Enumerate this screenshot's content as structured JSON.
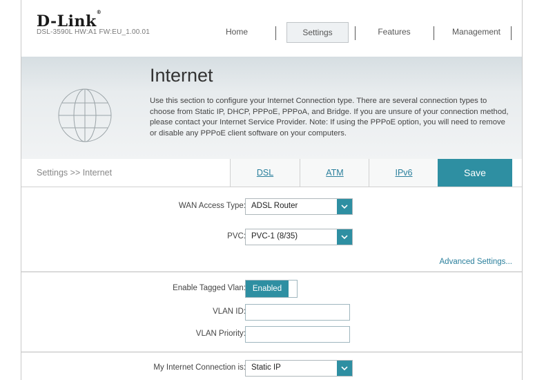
{
  "header": {
    "logo": "D-Link",
    "model_info": "DSL-3590L  HW:A1  FW:EU_1.00.01",
    "nav": [
      "Home",
      "Settings",
      "Features",
      "Management"
    ],
    "active_nav": "Settings"
  },
  "banner": {
    "title": "Internet",
    "description": "Use this section to configure your Internet Connection type. There are several connection types to choose from Static IP, DHCP, PPPoE, PPPoA, and Bridge. If you are unsure of your connection method, please contact your Internet Service Provider. Note: If using the PPPoE option, you will need to remove or disable any PPPoE client software on your computers."
  },
  "subbar": {
    "breadcrumb": "Settings >> Internet",
    "tabs": [
      "DSL",
      "ATM",
      "IPv6"
    ],
    "save_label": "Save"
  },
  "form": {
    "wan_access_type_label": "WAN Access Type:",
    "wan_access_type_value": "ADSL Router",
    "pvc_label": "PVC:",
    "pvc_value": "PVC-1 (8/35)",
    "advanced_settings": "Advanced Settings...",
    "tagged_vlan_label": "Enable Tagged Vlan:",
    "tagged_vlan_value": "Enabled",
    "vlan_id_label": "VLAN ID:",
    "vlan_id_value": "",
    "vlan_priority_label": "VLAN Priority:",
    "vlan_priority_value": "",
    "connection_label": "My Internet Connection is:",
    "connection_value": "Static IP"
  },
  "colors": {
    "accent": "#2e8fa2",
    "link": "#2a7f9c"
  }
}
